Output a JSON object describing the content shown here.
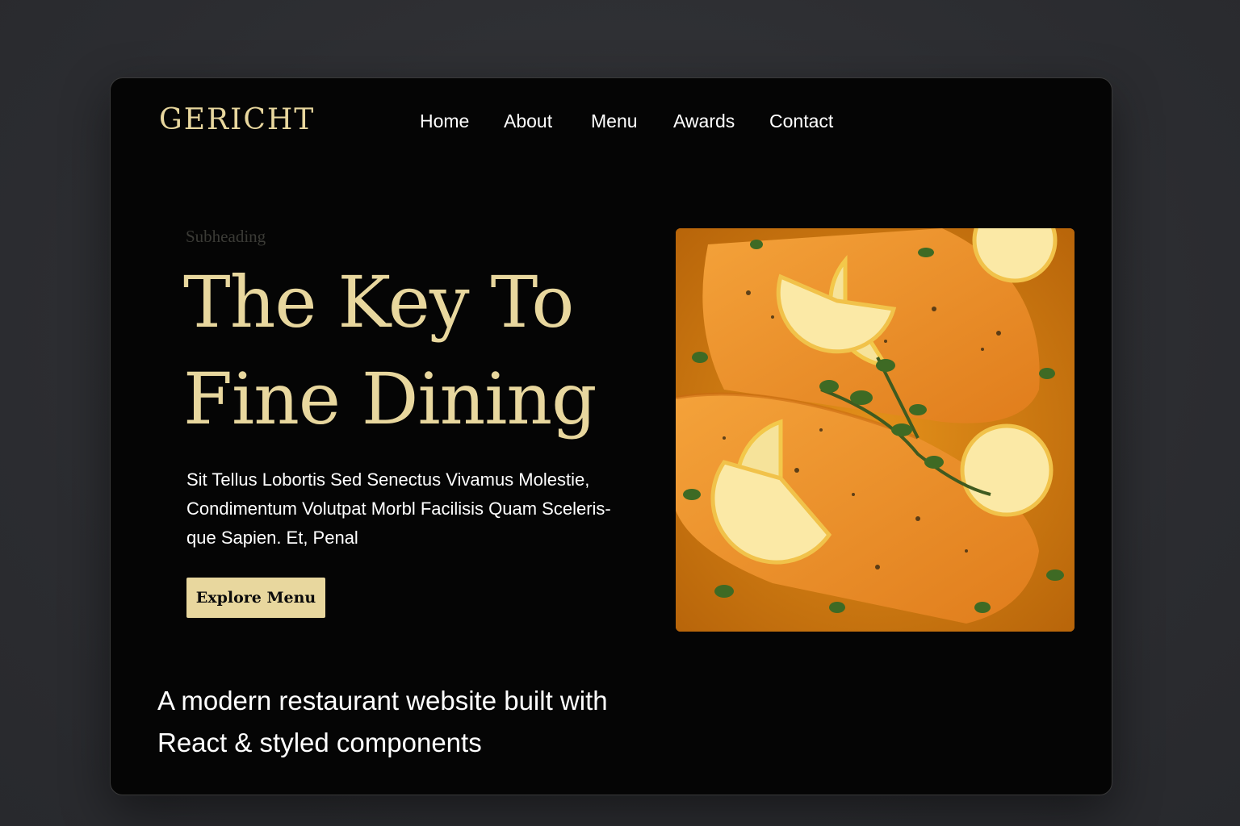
{
  "header": {
    "logo": "GERICHT",
    "nav": [
      "Home",
      "About",
      "Menu",
      "Awards",
      "Contact"
    ]
  },
  "hero": {
    "subheading": "Subheading",
    "headline_line1": "The Key To",
    "headline_line2": "Fine Dining",
    "description_line1": "Sit Tellus Lobortis Sed Senectus Vivamus Molestie,",
    "description_line2": "Condimentum Volutpat Morbl Facilisis Quam Sceleris-",
    "description_line3": "que Sapien. Et, Penal",
    "cta_label": "Explore Menu",
    "image_alt": "salmon-dish-photo"
  },
  "footer_caption": {
    "line1": "A modern restaurant website built with",
    "line2": "React & styled components"
  },
  "colors": {
    "gold": "#e8d79e",
    "background": "#050505",
    "text": "#ffffff"
  }
}
